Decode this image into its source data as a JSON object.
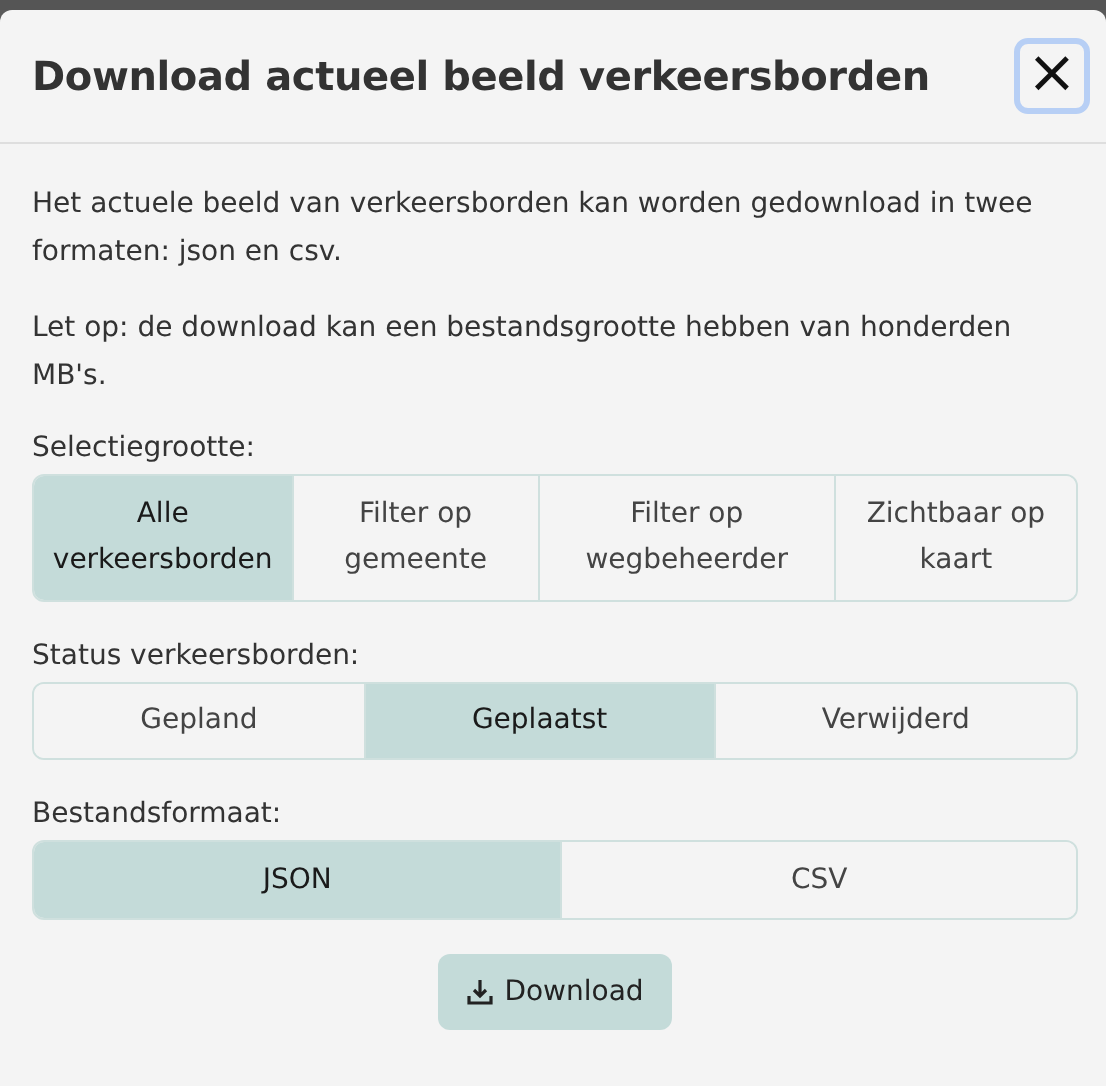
{
  "dialog": {
    "title": "Download actueel beeld verkeersborden",
    "close_label": "×"
  },
  "paragraphs": [
    "Het actuele beeld van verkeersborden kan worden gedownload in twee formaten: json en csv.",
    "Let op: de download kan een bestandsgrootte hebben van honderden MB's."
  ],
  "groups": [
    {
      "label": "Selectiegrootte:",
      "options": [
        {
          "label": "Alle verkeersborden",
          "selected": true
        },
        {
          "label": "Filter op gemeente",
          "selected": false
        },
        {
          "label": "Filter op wegbeheerder",
          "selected": false
        },
        {
          "label": "Zichtbaar op kaart",
          "selected": false
        }
      ]
    },
    {
      "label": "Status verkeersborden:",
      "options": [
        {
          "label": "Gepland",
          "selected": false
        },
        {
          "label": "Geplaatst",
          "selected": true
        },
        {
          "label": "Verwijderd",
          "selected": false
        }
      ]
    },
    {
      "label": "Bestandsformaat:",
      "options": [
        {
          "label": "JSON",
          "selected": true
        },
        {
          "label": "CSV",
          "selected": false
        }
      ]
    }
  ],
  "download_button": {
    "label": "Download"
  }
}
